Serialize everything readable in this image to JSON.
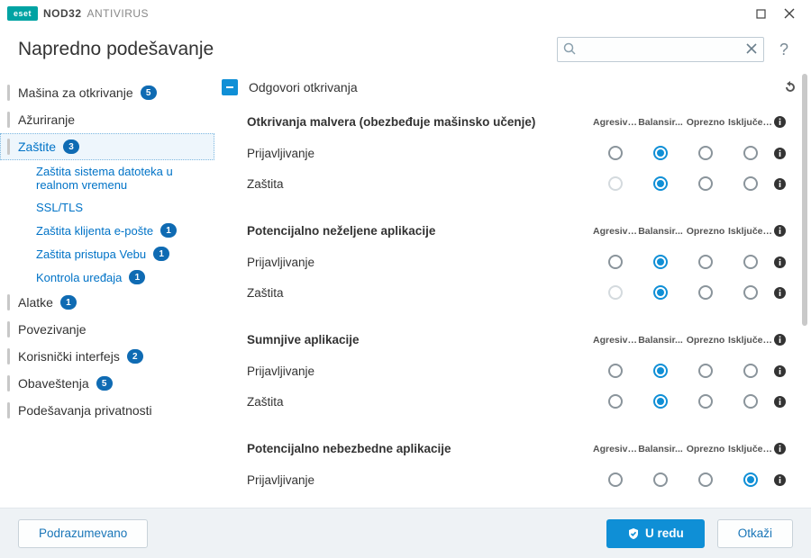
{
  "brand": {
    "logo": "eset",
    "name": "NOD32",
    "sub": "ANTIVIRUS"
  },
  "page_title": "Napredno podešavanje",
  "search": {
    "placeholder": ""
  },
  "sidebar": {
    "items": [
      {
        "label": "Mašina za otkrivanje",
        "badge": "5",
        "top": true
      },
      {
        "label": "Ažuriranje",
        "top": true
      },
      {
        "label": "Zaštite",
        "badge": "3",
        "top": true,
        "link": true,
        "active": true
      },
      {
        "label": "Zaštita sistema datoteka u realnom vremenu",
        "link": true,
        "sub": true
      },
      {
        "label": "SSL/TLS",
        "link": true,
        "sub": true
      },
      {
        "label": "Zaštita klijenta e-pošte",
        "badge": "1",
        "link": true,
        "sub": true
      },
      {
        "label": "Zaštita pristupa Vebu",
        "badge": "1",
        "link": true,
        "sub": true
      },
      {
        "label": "Kontrola uređaja",
        "badge": "1",
        "link": true,
        "sub": true
      },
      {
        "label": "Alatke",
        "badge": "1",
        "top": true
      },
      {
        "label": "Povezivanje",
        "top": true
      },
      {
        "label": "Korisnički interfejs",
        "badge": "2",
        "top": true
      },
      {
        "label": "Obaveštenja",
        "badge": "5",
        "top": true
      },
      {
        "label": "Podešavanja privatnosti",
        "top": true
      }
    ]
  },
  "section": {
    "title": "Odgovori otkrivanja",
    "columns": [
      "Agresivno",
      "Balansir...",
      "Oprezno",
      "Isključeno"
    ],
    "groups": [
      {
        "title": "Otkrivanja malvera (obezbeđuje mašinsko učenje)",
        "rows": [
          {
            "label": "Prijavljivanje",
            "selected": 1,
            "disabled": []
          },
          {
            "label": "Zaštita",
            "selected": 1,
            "disabled": [
              0
            ]
          }
        ]
      },
      {
        "title": "Potencijalno neželjene aplikacije",
        "rows": [
          {
            "label": "Prijavljivanje",
            "selected": 1,
            "disabled": []
          },
          {
            "label": "Zaštita",
            "selected": 1,
            "disabled": [
              0
            ]
          }
        ]
      },
      {
        "title": "Sumnjive aplikacije",
        "rows": [
          {
            "label": "Prijavljivanje",
            "selected": 1,
            "disabled": []
          },
          {
            "label": "Zaštita",
            "selected": 1,
            "disabled": []
          }
        ]
      },
      {
        "title": "Potencijalno nebezbedne aplikacije",
        "rows": [
          {
            "label": "Prijavljivanje",
            "selected": 3,
            "disabled": []
          }
        ]
      }
    ]
  },
  "footer": {
    "default_label": "Podrazumevano",
    "ok_label": "U redu",
    "cancel_label": "Otkaži"
  }
}
